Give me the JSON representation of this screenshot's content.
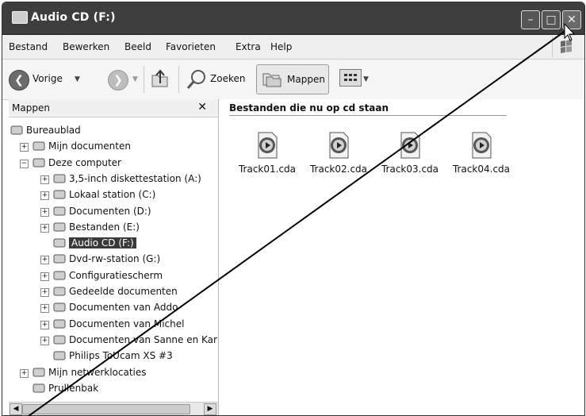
{
  "window": {
    "title": "Audio CD (F:)"
  },
  "menu": [
    "Bestand",
    "Bewerken",
    "Beeld",
    "Favorieten",
    "Extra",
    "Help"
  ],
  "toolbar": {
    "back_label": "Vorige",
    "search_label": "Zoeken",
    "folders_label": "Mappen"
  },
  "folder_pane": {
    "title": "Mappen",
    "close": "✕",
    "tree": [
      {
        "label": "Bureaublad",
        "level": 0,
        "expander": "",
        "icon": "desktop-icon"
      },
      {
        "label": "Mijn documenten",
        "level": 1,
        "expander": "+",
        "icon": "documents-folder-icon"
      },
      {
        "label": "Deze computer",
        "level": 1,
        "expander": "−",
        "icon": "computer-icon"
      },
      {
        "label": "3,5-inch diskettestation (A:)",
        "level": 2,
        "expander": "+",
        "icon": "floppy-icon"
      },
      {
        "label": "Lokaal station (C:)",
        "level": 2,
        "expander": "+",
        "icon": "hard-drive-icon"
      },
      {
        "label": "Documenten (D:)",
        "level": 2,
        "expander": "+",
        "icon": "hard-drive-icon"
      },
      {
        "label": "Bestanden (E:)",
        "level": 2,
        "expander": "+",
        "icon": "hard-drive-icon"
      },
      {
        "label": "Audio CD (F:)",
        "level": 2,
        "expander": "",
        "icon": "audio-cd-icon",
        "selected": true
      },
      {
        "label": "Dvd-rw-station (G:)",
        "level": 2,
        "expander": "+",
        "icon": "dvd-drive-icon"
      },
      {
        "label": "Configuratiescherm",
        "level": 2,
        "expander": "+",
        "icon": "control-panel-icon"
      },
      {
        "label": "Gedeelde documenten",
        "level": 2,
        "expander": "+",
        "icon": "shared-folder-icon"
      },
      {
        "label": "Documenten van Addo",
        "level": 2,
        "expander": "+",
        "icon": "folder-icon"
      },
      {
        "label": "Documenten van Michel",
        "level": 2,
        "expander": "+",
        "icon": "folder-icon"
      },
      {
        "label": "Documenten van Sanne en Kar",
        "level": 2,
        "expander": "+",
        "icon": "folder-icon"
      },
      {
        "label": "Philips ToUcam XS #3",
        "level": 2,
        "expander": "",
        "icon": "webcam-icon"
      },
      {
        "label": "Mijn netwerklocaties",
        "level": 1,
        "expander": "+",
        "icon": "network-icon"
      },
      {
        "label": "Prullenbak",
        "level": 1,
        "expander": "",
        "icon": "recycle-bin-icon"
      }
    ]
  },
  "content": {
    "header": "Bestanden die nu op cd staan",
    "files": [
      "Track01.cda",
      "Track02.cda",
      "Track03.cda",
      "Track04.cda"
    ]
  }
}
